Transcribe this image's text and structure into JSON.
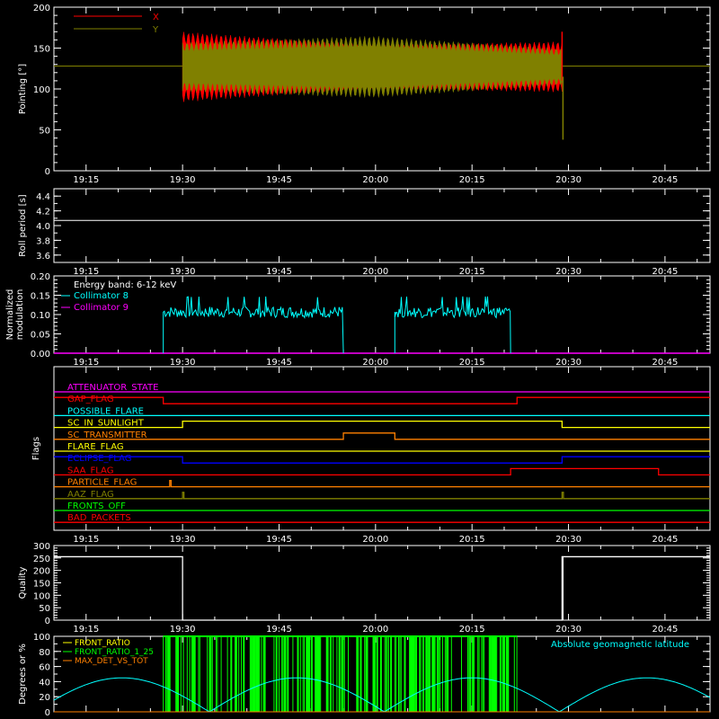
{
  "chart_data": [
    {
      "type": "line",
      "ylabel": "Pointing [°]",
      "ylim": [
        0,
        200
      ],
      "yticks": [
        0,
        50,
        100,
        150,
        200
      ],
      "xticks": [
        "19:15",
        "19:30",
        "19:45",
        "20:00",
        "20:15",
        "20:30",
        "20:45"
      ],
      "legend": "top-left",
      "series": [
        {
          "name": "X",
          "color": "#ff0000",
          "start": "19:30",
          "end": "20:29",
          "center": 127,
          "amplitude_start": 43,
          "amplitude_mid": 27,
          "amplitude_end": 31,
          "min_start": 65,
          "max_end": 170
        },
        {
          "name": "Y",
          "color": "#808000",
          "start": "19:30",
          "end": "20:29",
          "center": 127,
          "amplitude_start": 30,
          "amplitude_mid": 38,
          "amplitude_end": 22,
          "min_end": 38
        }
      ],
      "reference_line": {
        "value": 128,
        "color": "#808000"
      }
    },
    {
      "type": "line",
      "ylabel": "Roll period [s]",
      "ylim": [
        3.5,
        4.5
      ],
      "yticks": [
        "3.6",
        "3.8",
        "4.0",
        "4.2",
        "4.4"
      ],
      "xticks": [
        "19:15",
        "19:30",
        "19:45",
        "20:00",
        "20:15",
        "20:30",
        "20:45"
      ],
      "series": [
        {
          "name": "",
          "color": "#ffffff",
          "value": 4.07
        }
      ]
    },
    {
      "type": "line",
      "ylabel_lines": [
        "Normalized",
        "modulation"
      ],
      "ylim": [
        0,
        0.2
      ],
      "yticks": [
        "0.00",
        "0.05",
        "0.10",
        "0.15",
        "0.20"
      ],
      "xticks": [
        "19:15",
        "19:30",
        "19:45",
        "20:00",
        "20:15",
        "20:30",
        "20:45"
      ],
      "annotation": "Energy band: 6-12 keV",
      "legend": "top-left",
      "series": [
        {
          "name": "Collimator 8",
          "color": "#00ffff",
          "segments": [
            {
              "start": "19:27",
              "end": "19:55",
              "level": 0.107
            },
            {
              "start": "20:03",
              "end": "20:21",
              "level": 0.107
            }
          ]
        },
        {
          "name": "Collimator 9",
          "color": "#ff00ff",
          "value": 0.0
        }
      ]
    },
    {
      "type": "line",
      "ylabel": "Flags",
      "xticks": [
        "19:15",
        "19:30",
        "19:45",
        "20:00",
        "20:15",
        "20:30",
        "20:45"
      ],
      "flags": [
        {
          "name": "ATTENUATOR_STATE",
          "color": "#ff00ff",
          "steps": []
        },
        {
          "name": "GAP_FLAG",
          "color": "#ff0000",
          "steps": [
            {
              "start": "19:27",
              "end": "20:22"
            }
          ],
          "high_first": true
        },
        {
          "name": "POSSIBLE_FLARE",
          "color": "#00ffff",
          "steps": []
        },
        {
          "name": "SC_IN_SUNLIGHT",
          "color": "#ffff00",
          "steps": [
            {
              "start": "19:30",
              "end": "20:29"
            }
          ]
        },
        {
          "name": "SC_TRANSMITTER",
          "color": "#ff8000",
          "steps": [
            {
              "start": "19:55",
              "end": "20:03"
            }
          ]
        },
        {
          "name": "FLARE_FLAG",
          "color": "#ffff00",
          "steps": []
        },
        {
          "name": "ECLIPSE_FLAG",
          "color": "#0000ff",
          "steps": [
            {
              "start": "19:30",
              "end": "20:29"
            }
          ],
          "high_first": true
        },
        {
          "name": "SAA_FLAG",
          "color": "#ff0000",
          "steps": [
            {
              "start": "20:21",
              "end": "20:44"
            }
          ]
        },
        {
          "name": "PARTICLE_FLAG",
          "color": "#ff8000",
          "steps": [
            {
              "start": "19:28",
              "end": "19:28.2"
            }
          ]
        },
        {
          "name": "AAZ_FLAG",
          "color": "#808000",
          "steps": [
            {
              "start": "19:30",
              "end": "19:30.2"
            },
            {
              "start": "20:29",
              "end": "20:29.2"
            }
          ]
        },
        {
          "name": "FRONTS_OFF",
          "color": "#00ff00",
          "steps": []
        },
        {
          "name": "BAD_PACKETS",
          "color": "#ff0000",
          "steps": []
        }
      ]
    },
    {
      "type": "line",
      "ylabel": "Quality",
      "ylim": [
        0,
        300
      ],
      "yticks": [
        0,
        50,
        100,
        150,
        200,
        250,
        300
      ],
      "xticks": [
        "19:15",
        "19:30",
        "19:45",
        "20:00",
        "20:15",
        "20:30",
        "20:45"
      ],
      "series": [
        {
          "name": "",
          "color": "#ffffff",
          "high": 255,
          "low": 0,
          "low_start": "19:30",
          "low_end": "20:29"
        }
      ]
    },
    {
      "type": "line",
      "ylabel": "Degrees or %",
      "ylim": [
        0,
        100
      ],
      "yticks": [
        0,
        20,
        40,
        60,
        80,
        100
      ],
      "legend": "top-left",
      "annotation": "Absolute geomagnetic latitude",
      "series": [
        {
          "name": "FRONT_RATIO",
          "color": "#ffff00"
        },
        {
          "name": "FRONT_RATIO_1_25",
          "color": "#00ff00",
          "start": "19:27",
          "end": "20:22"
        },
        {
          "name": "MAX_DET_VS_TOT",
          "color": "#ff8000"
        },
        {
          "name": "Absolute geomagnetic latitude",
          "color": "#00ffff"
        }
      ]
    }
  ]
}
